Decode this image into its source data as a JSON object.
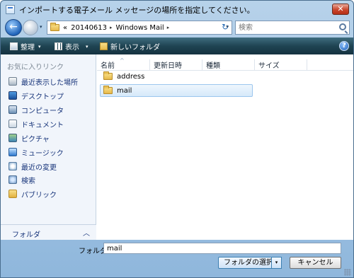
{
  "window": {
    "title": "インポートする電子メール メッセージの場所を指定してください。",
    "close_glyph": "✕"
  },
  "address": {
    "overflow": "«",
    "crumbs": [
      "20140613",
      "Windows Mail"
    ],
    "separator": "▸",
    "dropdown": "▾",
    "refresh_glyph": "↻"
  },
  "search": {
    "placeholder": "検索"
  },
  "toolbar": {
    "organize": "整理",
    "views": "表示",
    "new_folder": "新しいフォルダ",
    "dropdown": "▾",
    "help": "?"
  },
  "navigation": {
    "header": "お気に入りリンク",
    "items": [
      {
        "label": "最近表示した場所",
        "icon": "recent-places-icon"
      },
      {
        "label": "デスクトップ",
        "icon": "desktop-icon"
      },
      {
        "label": "コンピュータ",
        "icon": "computer-icon"
      },
      {
        "label": "ドキュメント",
        "icon": "documents-icon"
      },
      {
        "label": "ピクチャ",
        "icon": "pictures-icon"
      },
      {
        "label": "ミュージック",
        "icon": "music-icon"
      },
      {
        "label": "最近の変更",
        "icon": "recent-changes-icon"
      },
      {
        "label": "検索",
        "icon": "search-folder-icon"
      },
      {
        "label": "パブリック",
        "icon": "public-folder-icon"
      }
    ],
    "folders_label": "フォルダ",
    "folders_chevron": "︿"
  },
  "files": {
    "columns": [
      "名前",
      "更新日時",
      "種類",
      "サイズ"
    ],
    "sort_indicator": "^",
    "rows": [
      {
        "name": "address",
        "selected": false
      },
      {
        "name": "mail",
        "selected": true
      }
    ]
  },
  "footer": {
    "folder_label": "フォルダ:",
    "folder_value": "mail",
    "select_button": "フォルダの選択",
    "select_dropdown": "▾",
    "cancel_button": "キャンセル"
  },
  "colors": {
    "toolbar_bg": "#1f4453",
    "selection_bg": "#d6e9fa",
    "nav_link": "#17347a"
  }
}
